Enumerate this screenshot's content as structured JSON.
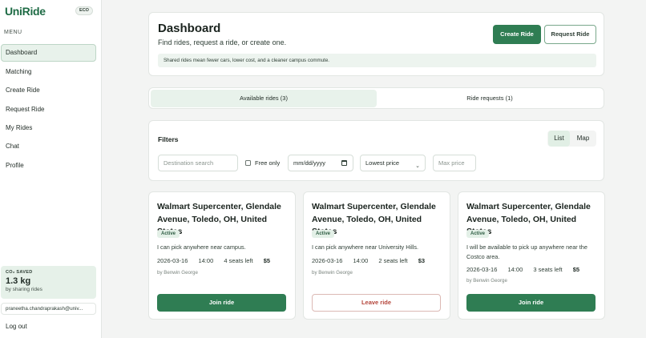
{
  "sidebar": {
    "brand": "UniRide",
    "eco_badge": "ECO",
    "menu_label": "MENU",
    "items": [
      {
        "label": "Dashboard"
      },
      {
        "label": "Matching"
      },
      {
        "label": "Create Ride"
      },
      {
        "label": "Request Ride"
      },
      {
        "label": "My Rides"
      },
      {
        "label": "Chat"
      },
      {
        "label": "Profile"
      }
    ],
    "co2": {
      "title": "CO₂ SAVED",
      "value": "1.3 kg",
      "sub": "by sharing rides"
    },
    "user_email": "praneetha.chandraprakash@univ...",
    "logout": "Log out"
  },
  "header": {
    "title": "Dashboard",
    "subtitle": "Find rides, request a ride, or create one.",
    "create_label": "Create Ride",
    "request_label": "Request Ride",
    "info": "Shared rides mean fewer cars, lower cost, and a cleaner campus commute."
  },
  "tabs": [
    {
      "label": "Available rides (3)"
    },
    {
      "label": "Ride requests (1)"
    }
  ],
  "filters": {
    "title": "Filters",
    "view_list": "List",
    "view_map": "Map",
    "destination_placeholder": "Destination search",
    "free_only": "Free only",
    "date_value": "mm/dd/yyyy",
    "sort_value": "Lowest price",
    "max_price_placeholder": "Max price"
  },
  "rides": [
    {
      "title": "Walmart Supercenter, Glendale Avenue, Toledo, OH, United States",
      "status": "Active",
      "description": "I can pick anywhere near campus.",
      "date": "2026-03-16",
      "time": "14:00",
      "seats": "4 seats left",
      "price": "$5",
      "driver": "by Benwin George",
      "action": "Join ride"
    },
    {
      "title": "Walmart Supercenter, Glendale Avenue, Toledo, OH, United States",
      "status": "Active",
      "description": "I can pick anywhere near University Hills.",
      "date": "2026-03-16",
      "time": "14:00",
      "seats": "2 seats left",
      "price": "$3",
      "driver": "by Benwin George",
      "action": "Leave ride"
    },
    {
      "title": "Walmart Supercenter, Glendale Avenue, Toledo, OH, United States",
      "status": "Active",
      "description": "I will be available to pick up anywhere near the Costco area.",
      "date": "2026-03-16",
      "time": "14:00",
      "seats": "3 seats left",
      "price": "$5",
      "driver": "by Benwin George",
      "action": "Join ride"
    }
  ]
}
